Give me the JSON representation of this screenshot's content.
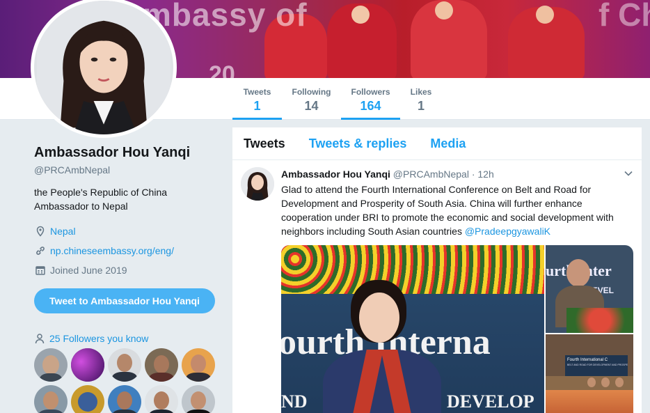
{
  "banner": {
    "text_left": "mbassy of",
    "text_right": "f Ch",
    "year": "20"
  },
  "nav": {
    "stats": [
      {
        "label": "Tweets",
        "value": "1"
      },
      {
        "label": "Following",
        "value": "14"
      },
      {
        "label": "Followers",
        "value": "164"
      },
      {
        "label": "Likes",
        "value": "1"
      }
    ]
  },
  "profile": {
    "name": "Ambassador Hou Yanqi",
    "handle": "@PRCAmbNepal",
    "bio": "the People's Republic of China Ambassador to Nepal",
    "location": "Nepal",
    "website": "np.chineseembassy.org/eng/",
    "joined": "Joined June 2019",
    "tweet_to_label": "Tweet to Ambassador Hou Yanqi",
    "followers_you_know": "25 Followers you know"
  },
  "timeline": {
    "tabs": [
      "Tweets",
      "Tweets & replies",
      "Media"
    ],
    "tweet": {
      "name": "Ambassador Hou Yanqi",
      "handle": "@PRCAmbNepal",
      "dot": "·",
      "time": "12h",
      "text": "Glad to attend the Fourth International Conference on Belt and Road for Development and Prosperity of South Asia. China will further enhance cooperation under BRI to promote the economic and social development with neighbors including South Asian countries ",
      "mention": "@PradeepgyawaliK",
      "media_main_text": "ourth Interna",
      "media_main_sub_left": "ND",
      "media_main_sub_right": "DEVELOP",
      "media_top_right_text": "urth Inter",
      "media_top_right_sub": "DEVEL",
      "media_bottom_right_title": "Fourth International C",
      "media_bottom_right_sub": "BELT AND ROAD FOR DEVELOPMENT AND PROSPER"
    }
  },
  "colors": {
    "accent": "#1da1f2",
    "link": "#1b95e0",
    "button": "#4ab3f4",
    "muted": "#657786"
  },
  "icons": [
    "location-icon",
    "link-icon",
    "calendar-icon",
    "followers-icon",
    "chevron-down-icon"
  ]
}
